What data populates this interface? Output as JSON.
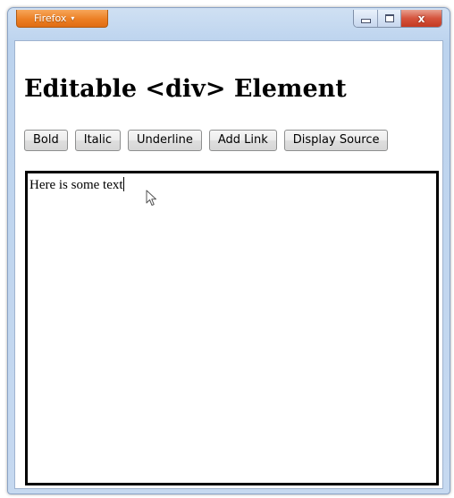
{
  "window": {
    "app_button_label": "Firefox",
    "app_button_arrow": "▾",
    "caption_buttons": {
      "minimize": "minimize-icon",
      "maximize": "maximize-icon",
      "close": "close-icon",
      "close_glyph": "x"
    }
  },
  "page": {
    "title": "Editable <div> Element"
  },
  "toolbar": {
    "buttons": [
      {
        "label": "Bold"
      },
      {
        "label": "Italic"
      },
      {
        "label": "Underline"
      },
      {
        "label": "Add Link"
      },
      {
        "label": "Display Source"
      }
    ]
  },
  "editor": {
    "text": "Here is some text"
  },
  "colors": {
    "app_button": "#ec7f24",
    "close_button": "#d5543d",
    "window_frame": "#c6d9f0",
    "editor_border": "#000000"
  }
}
